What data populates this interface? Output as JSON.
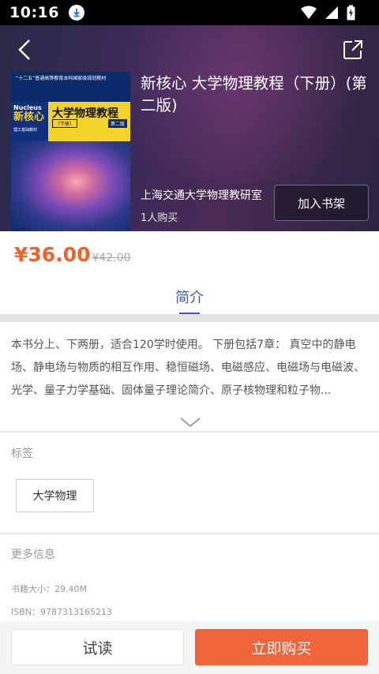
{
  "status_bar": {
    "time": "10:16"
  },
  "book": {
    "title": "新核心 大学物理教程（下册）(第二版)",
    "author": "上海交通大学物理教研室",
    "buyers": "1人购买",
    "add_shelf_label": "加入书架"
  },
  "cover": {
    "top_text": "“十二五”普通高等教育本科国家级规划教材",
    "series_en": "Nucleus",
    "series_cn": "新核心",
    "category": "理工基础教材",
    "title": "大学物理教程",
    "volume": "（下册）",
    "edition": "第二版"
  },
  "price": {
    "current": "¥36.00",
    "original": "¥42.00"
  },
  "tabs": [
    {
      "label": "简介"
    }
  ],
  "description": "本书分上、下两册，适合120学时使用。 下册包括7章： 真空中的静电场、静电场与物质的相互作用、稳恒磁场、电磁感应、电磁场与电磁波、光学、量子力学基础、固体量子理论简介、原子核物理和粒子物...",
  "tags_section": {
    "label": "标签",
    "tags": [
      "大学物理"
    ]
  },
  "more_info": {
    "label": "更多信息",
    "size": "书籍大小：29.40M",
    "isbn": "ISBN：9787313165213"
  },
  "actions": {
    "try_read": "试读",
    "buy_now": "立即购买"
  },
  "colors": {
    "accent": "#f0643c",
    "tab_blue": "#3a5bb5",
    "price": "#f0622a"
  }
}
